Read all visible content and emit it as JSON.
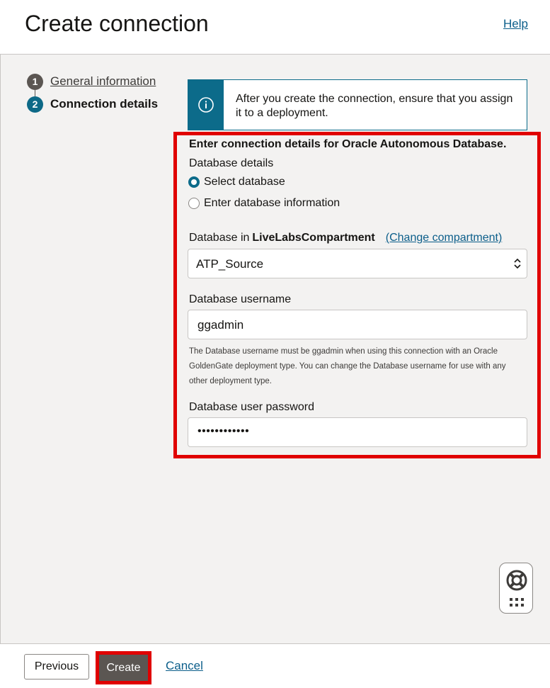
{
  "header": {
    "title": "Create connection",
    "help_link": "Help"
  },
  "steps": [
    {
      "number": "1",
      "label": "General information"
    },
    {
      "number": "2",
      "label": "Connection details"
    }
  ],
  "banner": {
    "text": "After you create the connection, ensure that you assign it to a deployment."
  },
  "form": {
    "section_title": "Enter connection details for Oracle Autonomous Database.",
    "database_details_label": "Database details",
    "radio_options": [
      "Select database",
      "Enter database information"
    ],
    "selected_option": "Select database",
    "compartment_prefix": "Database in",
    "compartment_name": "LiveLabsCompartment",
    "change_compartment_link": "(Change compartment)",
    "database_value": "ATP_Source",
    "username_label": "Database username",
    "username_value": "ggadmin",
    "username_hint": "The Database username must be ggadmin when using this connection with an Oracle GoldenGate deployment type. You can change the Database username for use with any other deployment type.",
    "password_label": "Database user password",
    "password_value": "••••••••••••"
  },
  "footer": {
    "previous": "Previous",
    "create": "Create",
    "cancel": "Cancel"
  },
  "colors": {
    "accent": "#0c6b8a",
    "highlight": "#e00000",
    "primary_button": "#5b5652"
  }
}
